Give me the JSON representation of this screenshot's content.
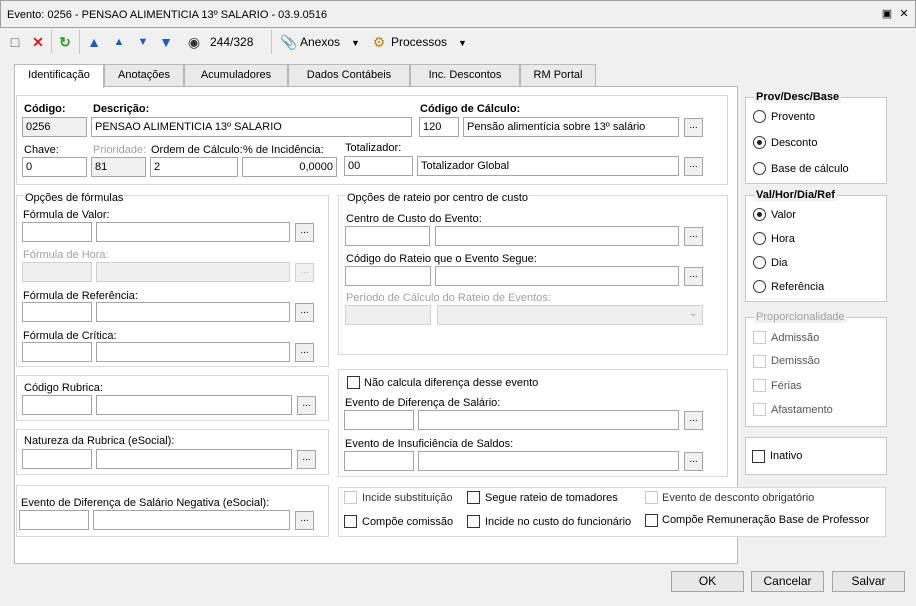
{
  "window": {
    "title": "Evento: 0256 - PENSAO ALIMENTICIA 13º SALARIO - 03.9.0516"
  },
  "toolbar": {
    "record_counter": "244/328",
    "attachments_label": "Anexos",
    "processes_label": "Processos"
  },
  "tabs": [
    "Identificação",
    "Anotações",
    "Acumuladores",
    "Dados Contábeis",
    "Inc. Descontos",
    "RM Portal"
  ],
  "ident": {
    "codigo_label": "Código:",
    "codigo": "0256",
    "descricao_label": "Descrição:",
    "descricao": "PENSAO ALIMENTICIA 13º SALARIO",
    "codcalc_label": "Código de Cálculo:",
    "codcalc": "120",
    "codcalc_desc": "Pensão alimentícia sobre 13º salário",
    "chave_label": "Chave:",
    "chave": "0",
    "prioridade_label": "Prioridade:",
    "prioridade": "81",
    "ordem_label": "Ordem de Cálculo:",
    "ordem": "2",
    "incidencia_label": "% de Incidência:",
    "incidencia": "0,0000",
    "totalizador_label": "Totalizador:",
    "totalizador": "00",
    "totalizador_desc": "Totalizador Global"
  },
  "formulas": {
    "title": "Opções de fórmulas",
    "valor_label": "Fórmula de Valor:",
    "hora_label": "Fórmula de Hora:",
    "referencia_label": "Fórmula de Referência:",
    "critica_label": "Fórmula de Crítica:"
  },
  "rateio": {
    "title": "Opções de rateio por centro de custo",
    "centro_label": "Centro de Custo do Evento:",
    "codigo_label": "Código do Rateio que o Evento Segue:",
    "periodo_label": "Período de Cálculo do Rateio de Eventos:"
  },
  "rubrica": {
    "codigo_label": "Código Rubrica:",
    "natureza_label": "Natureza da Rubrica (eSocial):"
  },
  "diferenca": {
    "nao_calcula_label": "Não calcula diferença desse evento",
    "evento_dif_label": "Evento de Diferença de Salário:",
    "evento_insuf_label": "Evento de Insuficiência de Saldos:",
    "dif_negativa_label": "Evento de Diferença de Salário Negativa (eSocial):"
  },
  "checks": {
    "incide_substituicao": "Incide substituição",
    "segue_rateio": "Segue rateio de tomadores",
    "desconto_obrigatorio": "Evento de desconto obrigatório",
    "compoe_comissao": "Compõe comissão",
    "incide_custo": "Incide no custo do funcionário",
    "compoe_remuneracao": "Compõe Remuneração Base de Professor"
  },
  "provdesc": {
    "title": "Prov/Desc/Base",
    "options": [
      "Provento",
      "Desconto",
      "Base de cálculo"
    ],
    "selected": "Desconto"
  },
  "valhor": {
    "title": "Val/Hor/Dia/Ref",
    "options": [
      "Valor",
      "Hora",
      "Dia",
      "Referência"
    ],
    "selected": "Valor"
  },
  "proporcionalidade": {
    "title": "Proporcionalidade",
    "options": [
      "Admissão",
      "Demissão",
      "Férias",
      "Afastamento"
    ]
  },
  "inativo_label": "Inativo",
  "buttons": {
    "ok": "OK",
    "cancel": "Cancelar",
    "save": "Salvar"
  }
}
